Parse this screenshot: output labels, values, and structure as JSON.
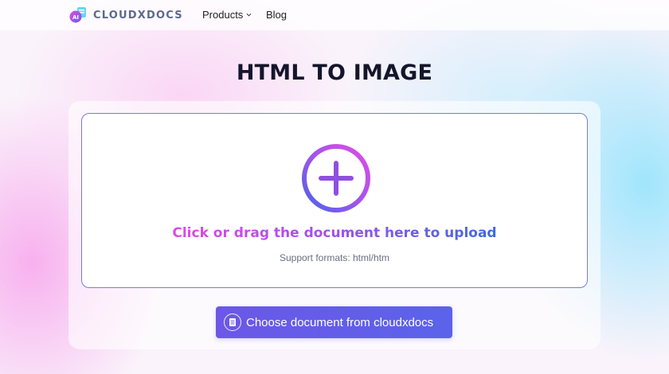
{
  "brand": {
    "name": "CLOUDXDOCS",
    "logo_badge": "AI"
  },
  "nav": {
    "products": "Products",
    "blog": "Blog"
  },
  "page": {
    "title": "HTML TO IMAGE"
  },
  "upload": {
    "prompt": "Click or drag the document here to upload",
    "formats": "Support formats: html/htm"
  },
  "choose_button": {
    "label": "Choose document from cloudxdocs"
  },
  "icons": {
    "logo": "cloudxdocs-logo-icon",
    "chevron": "chevron-down-icon",
    "plus": "plus-circle-icon",
    "document": "document-icon"
  },
  "colors": {
    "accent": "#6c57e8",
    "gradient_start": "#e346e8",
    "gradient_end": "#3a6ae4",
    "title": "#15152b",
    "dropzone_border": "#7b78e6"
  }
}
